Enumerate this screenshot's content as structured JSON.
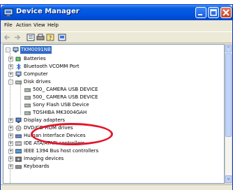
{
  "window": {
    "title": "Device Manager",
    "title_icon": "computer-management-icon"
  },
  "menu": [
    "File",
    "Action",
    "View",
    "Help"
  ],
  "toolbar": {
    "icons": [
      "back-arrow-icon",
      "forward-arrow-icon",
      "properties-icon",
      "print-icon",
      "help-icon",
      "scan-hardware-icon"
    ]
  },
  "tree": {
    "root": "TKM0091NB",
    "items": [
      {
        "label": "Batteries",
        "icon": "battery-icon",
        "expander": "+"
      },
      {
        "label": "Bluetooth VCOMM Port",
        "icon": "bluetooth-icon",
        "expander": "+"
      },
      {
        "label": "Computer",
        "icon": "computer-icon",
        "expander": "+"
      },
      {
        "label": "Disk drives",
        "icon": "disk-drive-icon",
        "expander": "-"
      },
      {
        "label": "500_ CAMERA USB DEVICE",
        "icon": "disk-icon",
        "child": true
      },
      {
        "label": "500_ CAMERA USB DEVICE",
        "icon": "disk-icon",
        "child": true
      },
      {
        "label": "Sony Flash USB Device",
        "icon": "disk-icon",
        "child": true
      },
      {
        "label": "TOSHIBA MK3004GAH",
        "icon": "disk-icon",
        "child": true
      },
      {
        "label": "Display adapters",
        "icon": "display-icon",
        "expander": "+"
      },
      {
        "label": "DVD/CD-ROM drives",
        "icon": "cdrom-icon",
        "expander": "+"
      },
      {
        "label": "Human Interface Devices",
        "icon": "hid-icon",
        "expander": "+"
      },
      {
        "label": "IDE ATA/ATAPI controllers",
        "icon": "ide-icon",
        "expander": "+"
      },
      {
        "label": "IEEE 1394 Bus host controllers",
        "icon": "firewire-icon",
        "expander": "+"
      },
      {
        "label": "Imaging devices",
        "icon": "camera-icon",
        "expander": "+"
      },
      {
        "label": "Keyboards",
        "icon": "keyboard-icon",
        "expander": "+"
      }
    ]
  },
  "colors": {
    "title_bar": "#0054e3",
    "selection": "#316ac5",
    "highlight_circle": "#e3162b"
  }
}
